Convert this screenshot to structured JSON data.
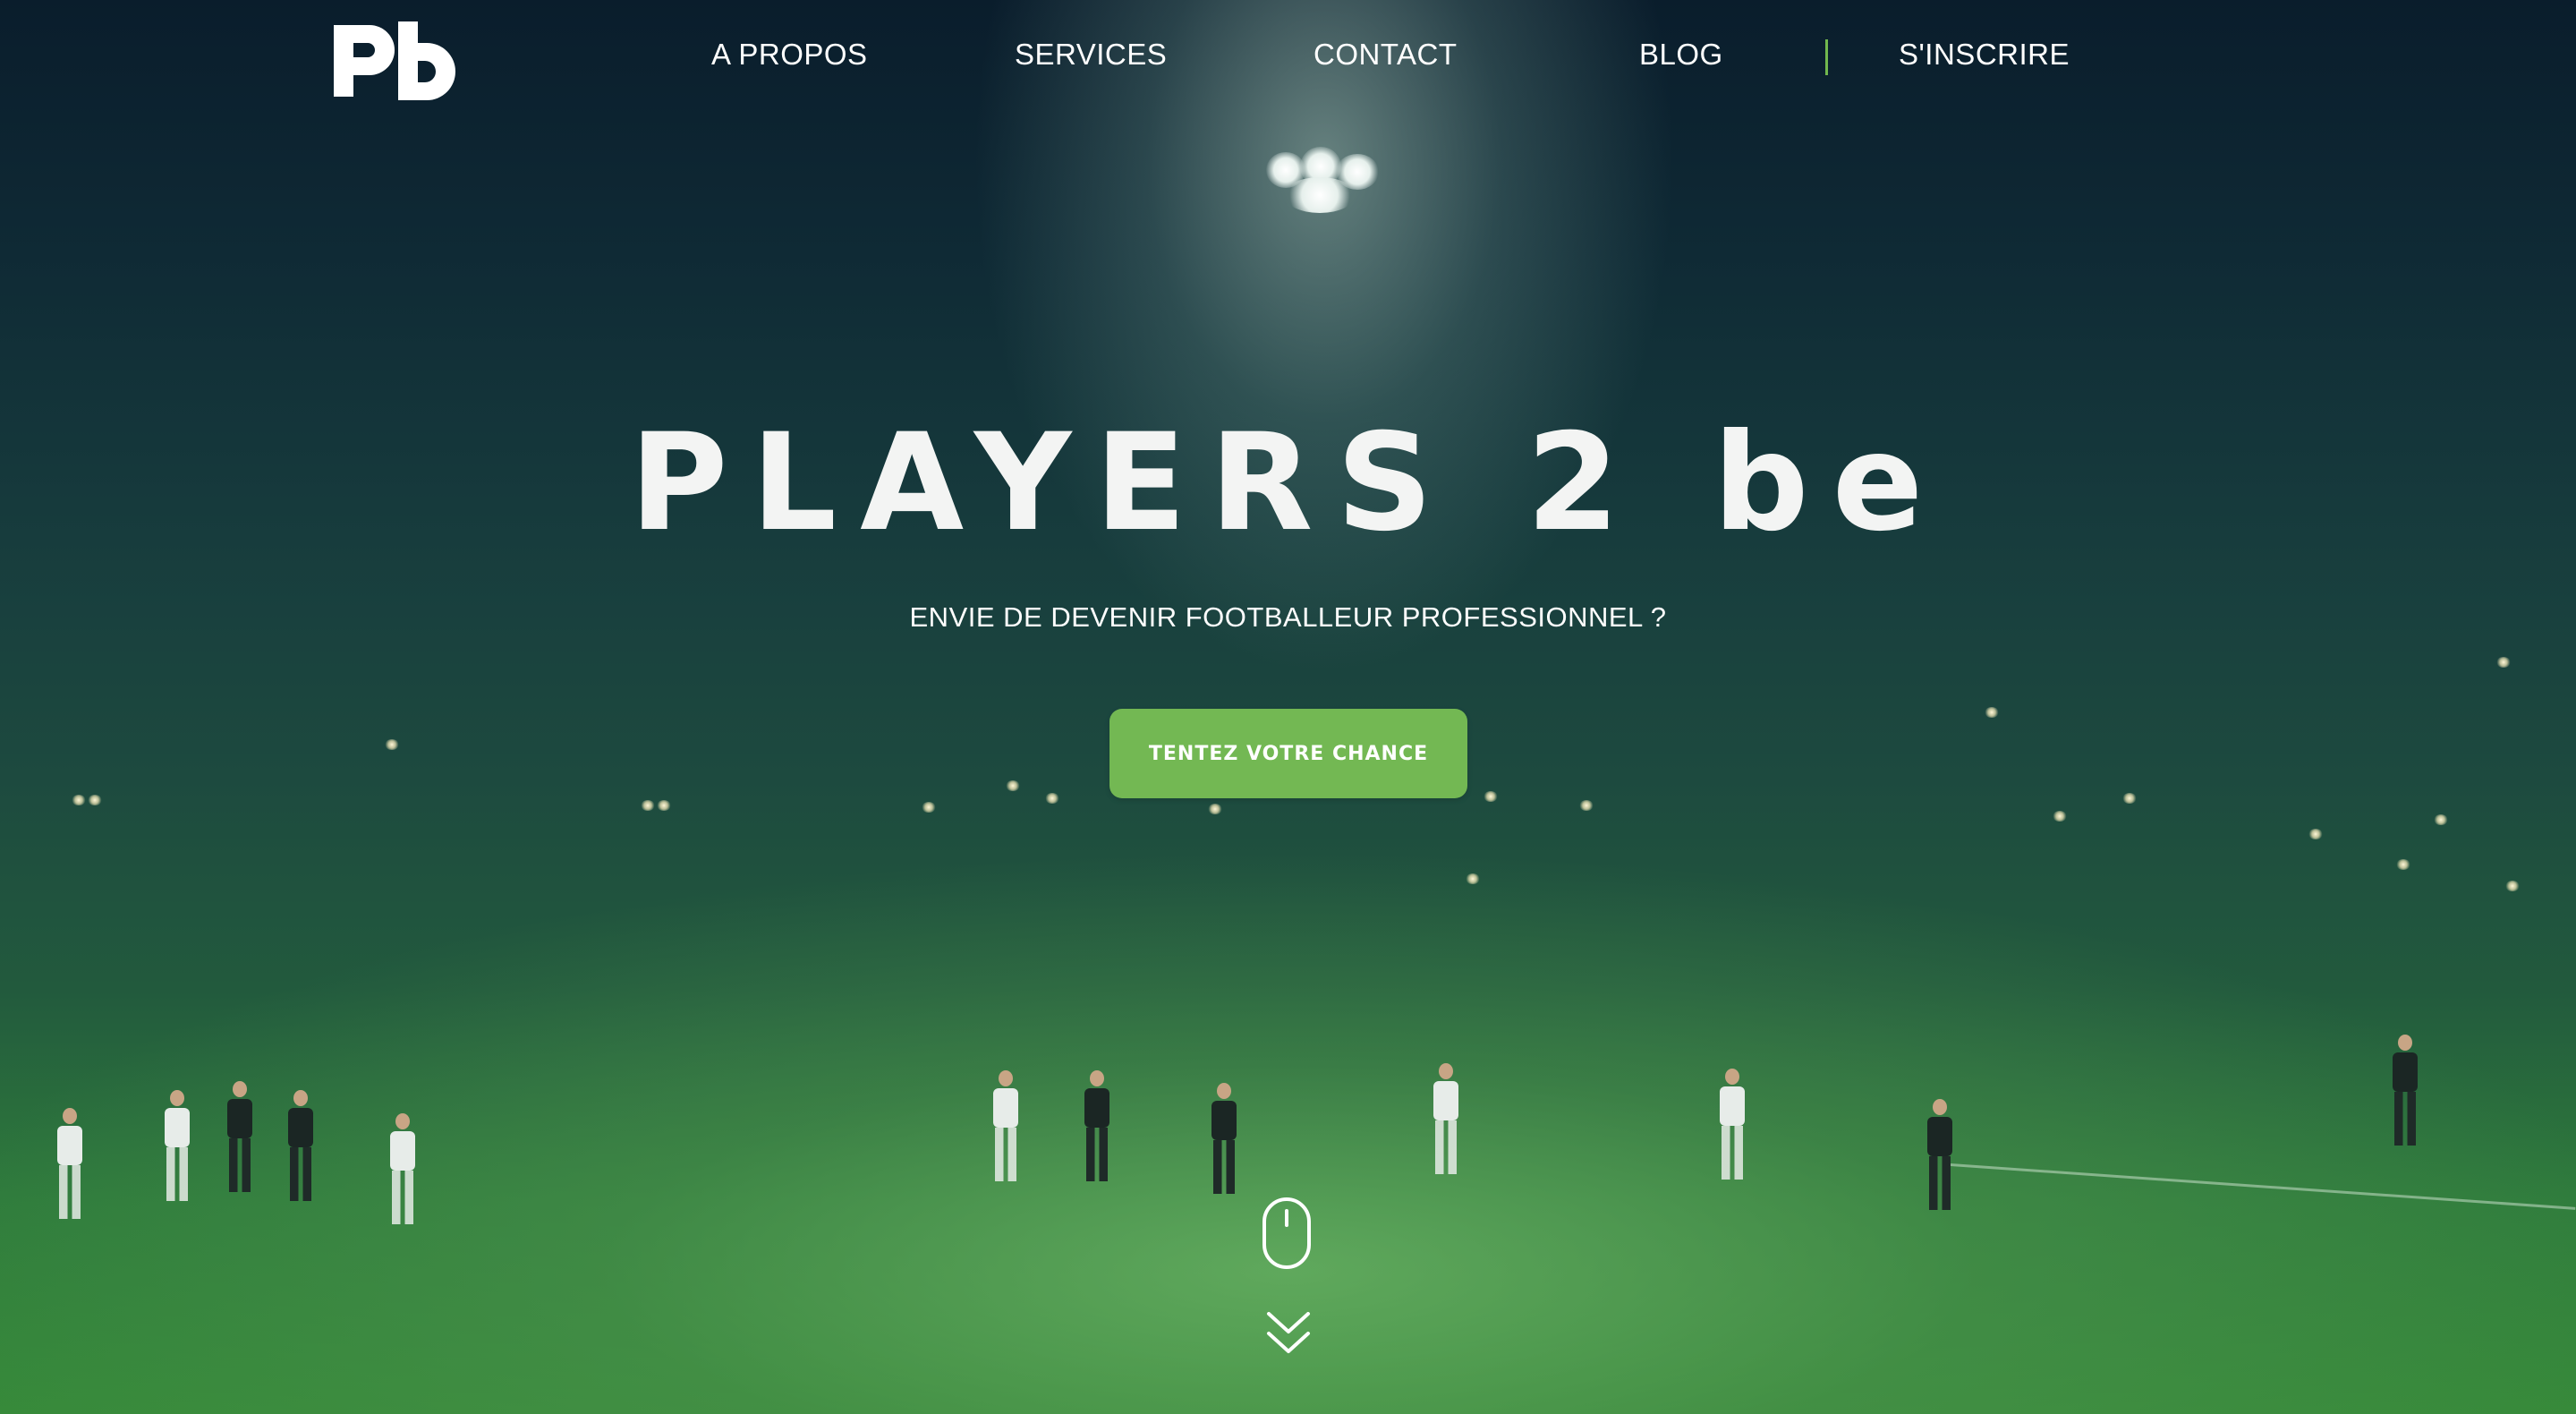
{
  "nav": {
    "logo_icon": "players2be-logo-icon",
    "items": [
      {
        "label": "A PROPOS"
      },
      {
        "label": "SERVICES"
      },
      {
        "label": "CONTACT"
      },
      {
        "label": "BLOG"
      },
      {
        "label": "S'INSCRIRE"
      }
    ],
    "divider_color": "#72b84e"
  },
  "hero": {
    "title": "PLAYERS 2 be",
    "subtitle": "ENVIE DE DEVENIR FOOTBALLEUR PROFESSIONNEL ?",
    "cta_label": "TENTEZ VOTRE CHANCE",
    "cta_color": "#73b853",
    "scroll_icon": "mouse-scroll-icon",
    "scroll_down_icon": "double-chevron-down-icon"
  }
}
